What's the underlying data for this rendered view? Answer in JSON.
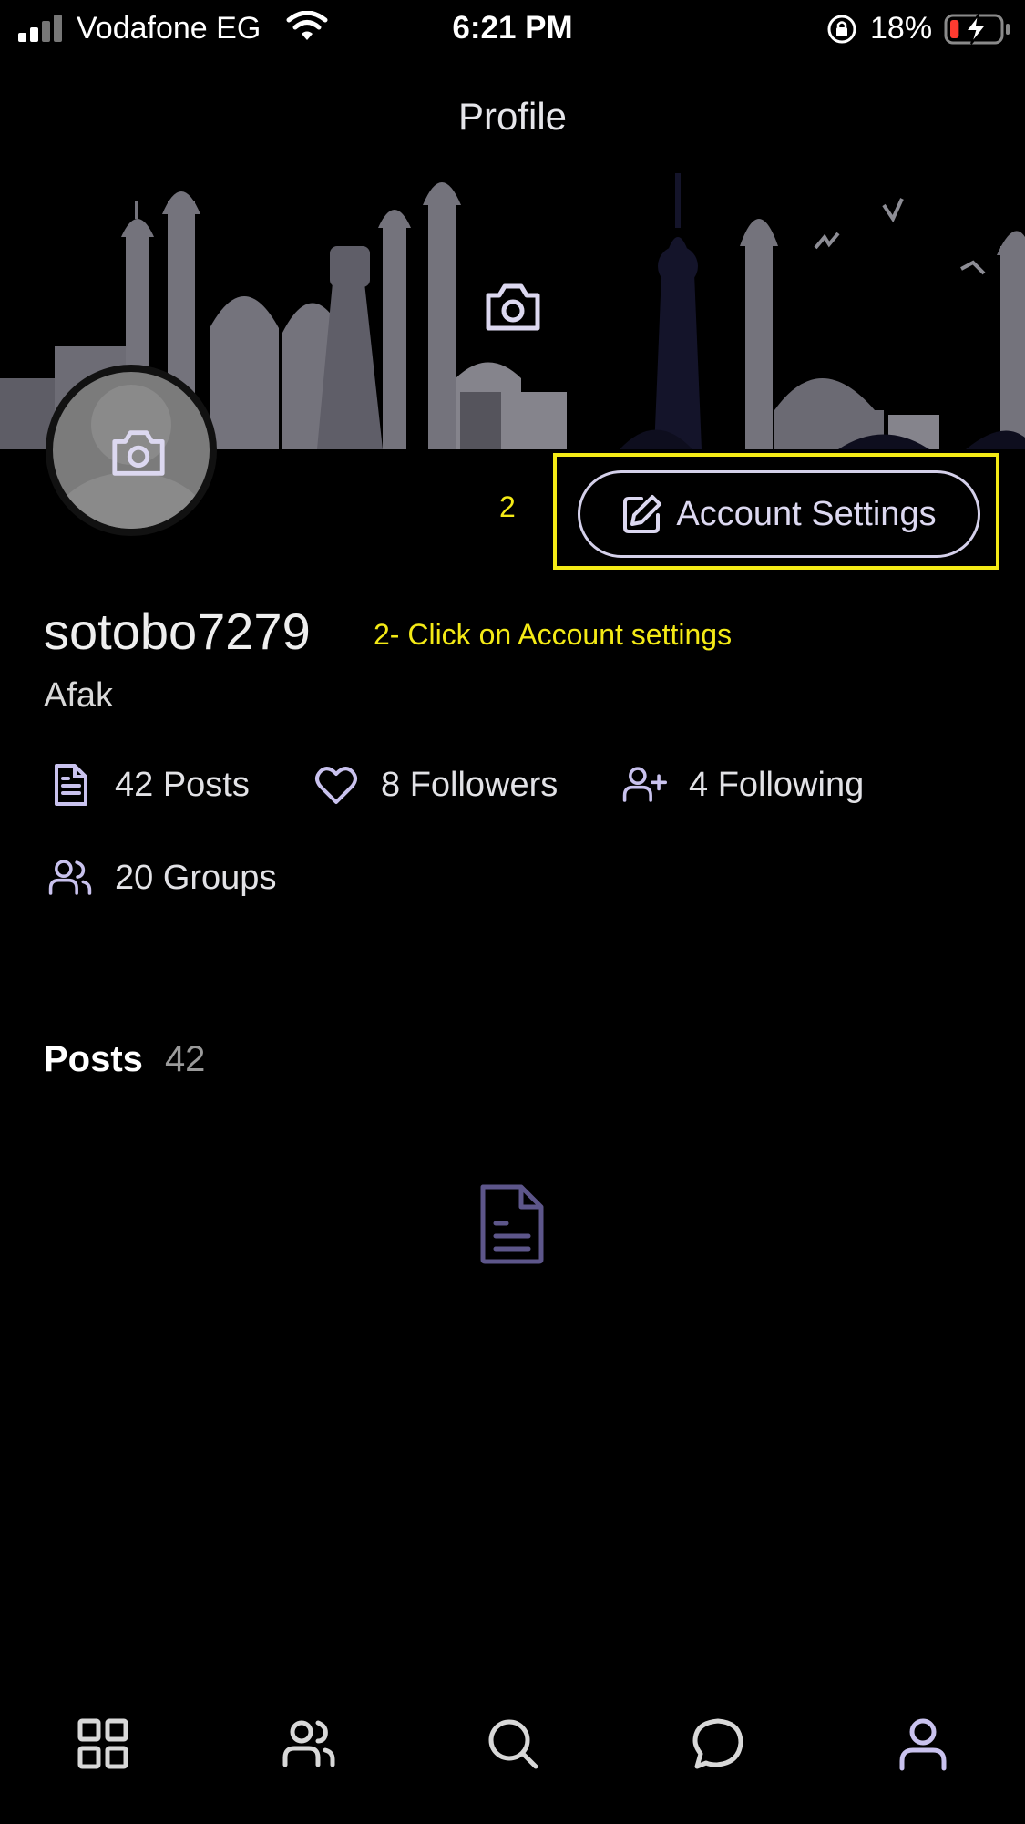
{
  "status_bar": {
    "carrier": "Vodafone EG",
    "time": "6:21 PM",
    "battery_percent": "18%",
    "battery_level": 0.18
  },
  "header": {
    "title": "Profile"
  },
  "profile": {
    "username": "sotobo7279",
    "display_name": "Afak",
    "account_settings_label": "Account Settings",
    "stats": {
      "posts": "42 Posts",
      "followers": "8 Followers",
      "following": "4 Following",
      "groups": "20 Groups"
    }
  },
  "annotation": {
    "step_number": "2",
    "instruction": "2- Click on Account settings"
  },
  "posts_section": {
    "label": "Posts",
    "count": "42"
  },
  "bottom_nav": {
    "items": [
      "grid-icon",
      "users-icon",
      "search-icon",
      "chat-icon",
      "profile-icon"
    ]
  },
  "colors": {
    "background": "#000000",
    "accent": "#c9c2ee",
    "annotation": "#f4ea16",
    "skyline_light": "#74737c",
    "skyline_dark": "#14142a"
  }
}
